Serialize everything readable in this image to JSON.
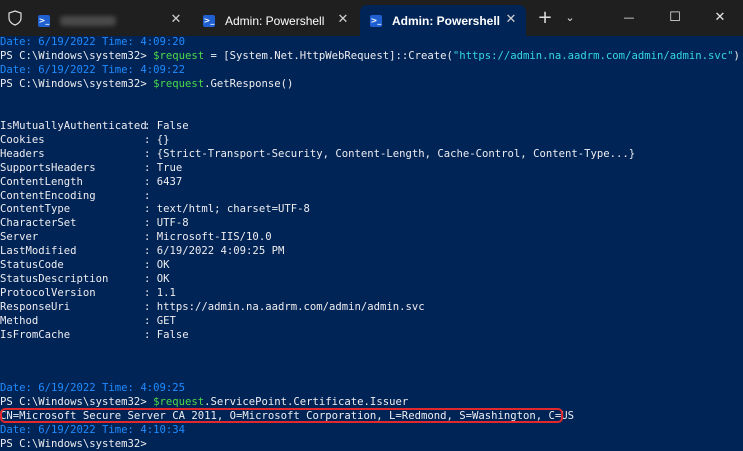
{
  "colors": {
    "terminal_bg": "#012456",
    "titlebar_bg": "#1f1f1f",
    "prompt": "#eeedf0",
    "variable": "#49d94a",
    "string": "#34d7e0",
    "date_stamp": "#1f8cff",
    "highlight_border": "#e0282d"
  },
  "titlebar": {
    "tabs": [
      {
        "label": "",
        "icon": "powershell-icon",
        "close": "✕"
      },
      {
        "label": "Admin: Powershell",
        "icon": "powershell-icon",
        "close": "✕"
      },
      {
        "label": "Admin: Powershell",
        "icon": "powershell-icon",
        "close": "✕"
      }
    ],
    "new_tab": "+",
    "dropdown": "⌄",
    "minimize": "—",
    "maximize": "☐",
    "close": "✕"
  },
  "terminal": {
    "line1": {
      "date": "Date: 6/19/2022 Time: 4:09:20"
    },
    "line2": {
      "prompt": "PS C:\\Windows\\system32> ",
      "var": "$request",
      "mid": " = [System.Net.HttpWebRequest]::Create(",
      "str": "\"https://admin.na.aadrm.com/admin/admin.svc\"",
      "end": ")"
    },
    "line3": {
      "date": "Date: 6/19/2022 Time: 4:09:22"
    },
    "line4": {
      "prompt": "PS C:\\Windows\\system32> ",
      "var": "$request",
      "rest": ".GetResponse()"
    },
    "properties": [
      {
        "name": "IsMutuallyAuthenticated",
        "value": "False"
      },
      {
        "name": "Cookies",
        "value": "{}"
      },
      {
        "name": "Headers",
        "value": "{Strict-Transport-Security, Content-Length, Cache-Control, Content-Type...}"
      },
      {
        "name": "SupportsHeaders",
        "value": "True"
      },
      {
        "name": "ContentLength",
        "value": "6437"
      },
      {
        "name": "ContentEncoding",
        "value": ""
      },
      {
        "name": "ContentType",
        "value": "text/html; charset=UTF-8"
      },
      {
        "name": "CharacterSet",
        "value": "UTF-8"
      },
      {
        "name": "Server",
        "value": "Microsoft-IIS/10.0"
      },
      {
        "name": "LastModified",
        "value": "6/19/2022 4:09:25 PM"
      },
      {
        "name": "StatusCode",
        "value": "OK"
      },
      {
        "name": "StatusDescription",
        "value": "OK"
      },
      {
        "name": "ProtocolVersion",
        "value": "1.1"
      },
      {
        "name": "ResponseUri",
        "value": "https://admin.na.aadrm.com/admin/admin.svc"
      },
      {
        "name": "Method",
        "value": "GET"
      },
      {
        "name": "IsFromCache",
        "value": "False"
      }
    ],
    "line5": {
      "date": "Date: 6/19/2022 Time: 4:09:25"
    },
    "line6": {
      "prompt": "PS C:\\Windows\\system32> ",
      "var": "$request",
      "rest": ".ServicePoint.Certificate.Issuer"
    },
    "line7": {
      "output": "CN=Microsoft Secure Server CA 2011, O=Microsoft Corporation, L=Redmond, S=Washington, C=US"
    },
    "line8": {
      "date": "Date: 6/19/2022 Time: 4:10:34"
    },
    "line9": {
      "prompt": "PS C:\\Windows\\system32> "
    }
  }
}
